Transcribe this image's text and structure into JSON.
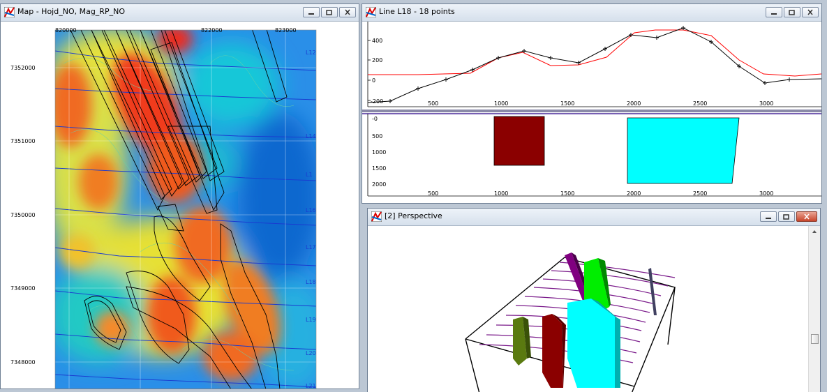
{
  "map_window": {
    "title": "Map - Hojd_NO, Mag_RP_NO",
    "x_ticks": [
      "820000",
      "822000",
      "823000"
    ],
    "y_ticks": [
      "7352000",
      "7351000",
      "7350000",
      "7349000",
      "7348000"
    ],
    "line_labels": [
      "L12",
      "L14",
      "L1",
      "L16",
      "L17",
      "L18",
      "L19",
      "L20",
      "L21"
    ]
  },
  "line_window": {
    "title": "Line L18 - 18 points",
    "profile_y_ticks": [
      "400",
      "200",
      "0",
      "-200"
    ],
    "section_y_ticks": [
      "-0",
      "500",
      "1000",
      "1500",
      "2000"
    ],
    "x_ticks": [
      "500",
      "1000",
      "1500",
      "2000",
      "2500",
      "3000"
    ],
    "observed_color": "#000000",
    "calculated_color": "#ff0000",
    "body_colors": [
      "#8b0000",
      "#00ffff"
    ]
  },
  "perspective_window": {
    "title": "[2] Perspective",
    "body_colors": [
      "#800080",
      "#00ee00",
      "#00ffff",
      "#8b0000",
      "#5a7a10",
      "#404060"
    ],
    "line_color": "#7a1a8a"
  },
  "icons": [
    "app-icon",
    "minimize-icon",
    "restore-icon",
    "close-icon"
  ]
}
